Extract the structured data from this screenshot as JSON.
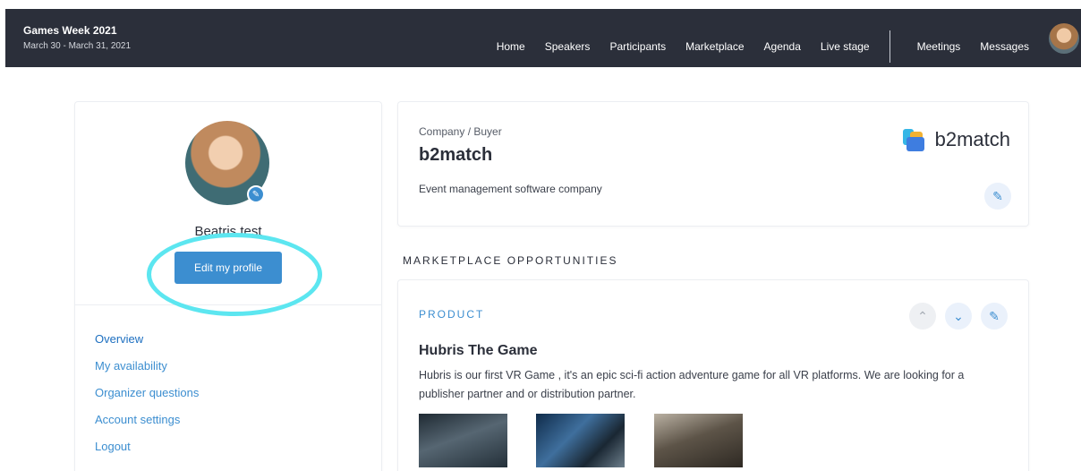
{
  "header": {
    "event_title": "Games Week 2021",
    "event_dates": "March 30 - March 31, 2021",
    "nav": [
      "Home",
      "Speakers",
      "Participants",
      "Marketplace",
      "Agenda",
      "Live stage"
    ],
    "nav_secondary": [
      "Meetings",
      "Messages"
    ],
    "user_avatar_icon": "user-avatar"
  },
  "profile": {
    "name": "Beatris test",
    "edit_button": "Edit my profile",
    "highlight_color": "#5ce6f0",
    "menu": [
      "Overview",
      "My availability",
      "Organizer questions",
      "Account settings",
      "Logout"
    ]
  },
  "company": {
    "type": "Company / Buyer",
    "name": "b2match",
    "description": "Event management software company",
    "brand_text": "b2match",
    "edit_icon": "pencil-icon"
  },
  "marketplace": {
    "heading": "MARKETPLACE OPPORTUNITIES",
    "opportunity": {
      "type": "PRODUCT",
      "title": "Hubris The Game",
      "description": "Hubris is our first VR Game , it's an epic sci-fi action adventure game for all VR platforms.  We are looking for a publisher partner and or distribution partner.",
      "icons": [
        "chevron-up-icon",
        "chevron-down-icon",
        "pencil-icon"
      ]
    }
  },
  "colors": {
    "accent": "#3c8ed0",
    "header_bg": "#2b2f3a"
  }
}
